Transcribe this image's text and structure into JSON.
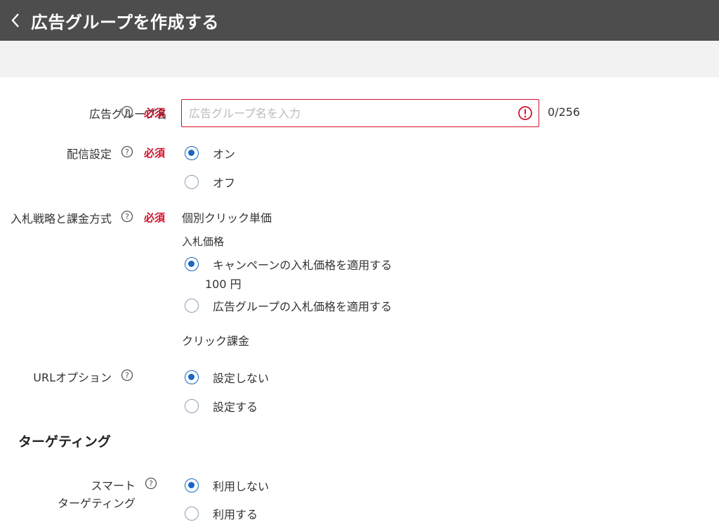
{
  "header": {
    "title": "広告グループを作成する"
  },
  "form": {
    "ad_group_name": {
      "label": "広告グループ名",
      "required": "必須",
      "placeholder": "広告グループ名を入力",
      "counter": "0/256"
    },
    "delivery": {
      "label": "配信設定",
      "required": "必須",
      "options": [
        "オン",
        "オフ"
      ],
      "selected": "オン"
    },
    "bidding": {
      "label": "入札戦略と課金方式",
      "required": "必須",
      "strategy": "個別クリック単価",
      "bid_price_heading": "入札価格",
      "options": [
        "キャンペーンの入札価格を適用する",
        "広告グループの入札価格を適用する"
      ],
      "selected": "キャンペーンの入札価格を適用する",
      "campaign_price": "100 円",
      "billing": "クリック課金"
    },
    "url_option": {
      "label": "URLオプション",
      "options": [
        "設定しない",
        "設定する"
      ],
      "selected": "設定しない"
    }
  },
  "targeting": {
    "section_title": "ターゲティング",
    "smart": {
      "label_line1": "スマート",
      "label_line2": "ターゲティング",
      "options": [
        "利用しない",
        "利用する"
      ],
      "selected": "利用しない"
    }
  },
  "colors": {
    "header_bg": "#4d4d4d",
    "required": "#d0112b",
    "radio_selected": "#1a66c5"
  }
}
